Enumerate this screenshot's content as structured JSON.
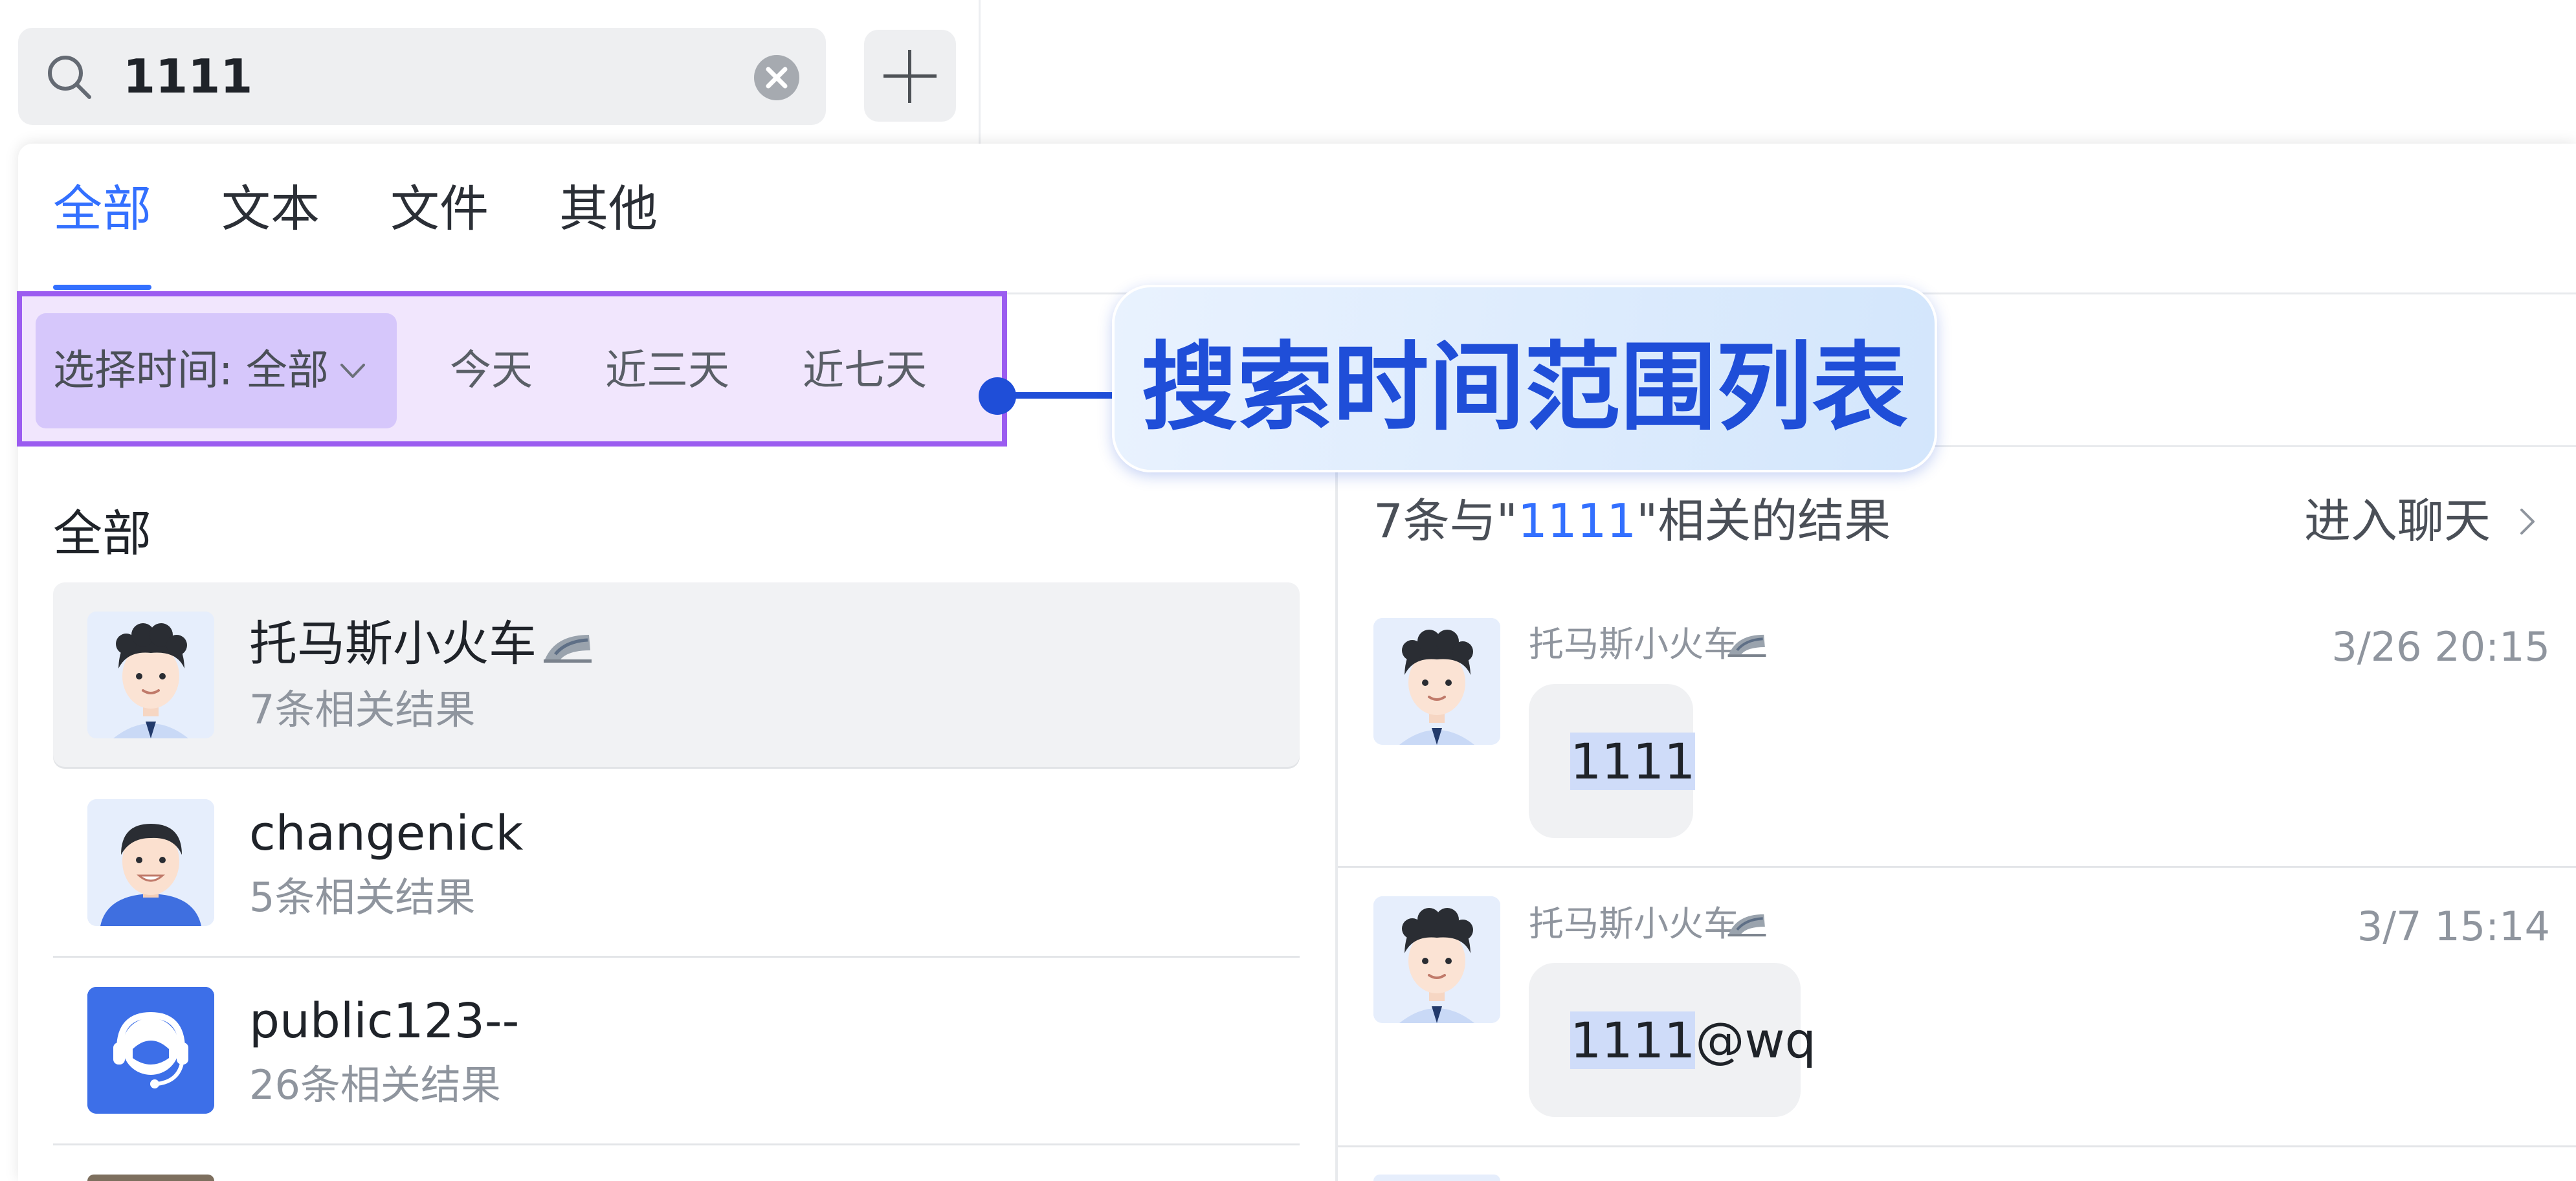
{
  "search": {
    "value": "1111",
    "icon": "search-icon",
    "clear_icon": "clear-icon",
    "add_icon": "plus-icon"
  },
  "tabs": [
    {
      "label": "全部",
      "active": true
    },
    {
      "label": "文本",
      "active": false
    },
    {
      "label": "文件",
      "active": false
    },
    {
      "label": "其他",
      "active": false
    }
  ],
  "time_filter": {
    "select_label": "选择时间: 全部",
    "options": [
      "今天",
      "近三天",
      "近七天"
    ]
  },
  "annotation": {
    "text": "搜索时间范围列表",
    "color": "#1f4ed8",
    "highlight_border": "#9b5cf0"
  },
  "list": {
    "section_label": "全部",
    "items": [
      {
        "name": "托马斯小火车",
        "sub": "7条相关结果",
        "avatar": "cartoon-boy-avatar",
        "selected": true
      },
      {
        "name": "changenick",
        "sub": "5条相关结果",
        "avatar": "cartoon-man-avatar",
        "selected": false
      },
      {
        "name": "public123--",
        "sub": "26条相关结果",
        "avatar": "support-headset-avatar",
        "selected": false
      }
    ]
  },
  "results": {
    "count_prefix": "7条与\"",
    "keyword": "1111",
    "count_suffix": "\"相关的结果",
    "enter_chat": "进入聊天",
    "messages": [
      {
        "sender": "托马斯小火车",
        "time": "3/26 20:15",
        "hl": "1111",
        "rest": ""
      },
      {
        "sender": "托马斯小火车",
        "time": "3/7 15:14",
        "hl": "1111",
        "rest": "@wq"
      }
    ]
  },
  "colors": {
    "accent": "#3370ff",
    "avatar_support_bg": "#3d6fe8"
  }
}
